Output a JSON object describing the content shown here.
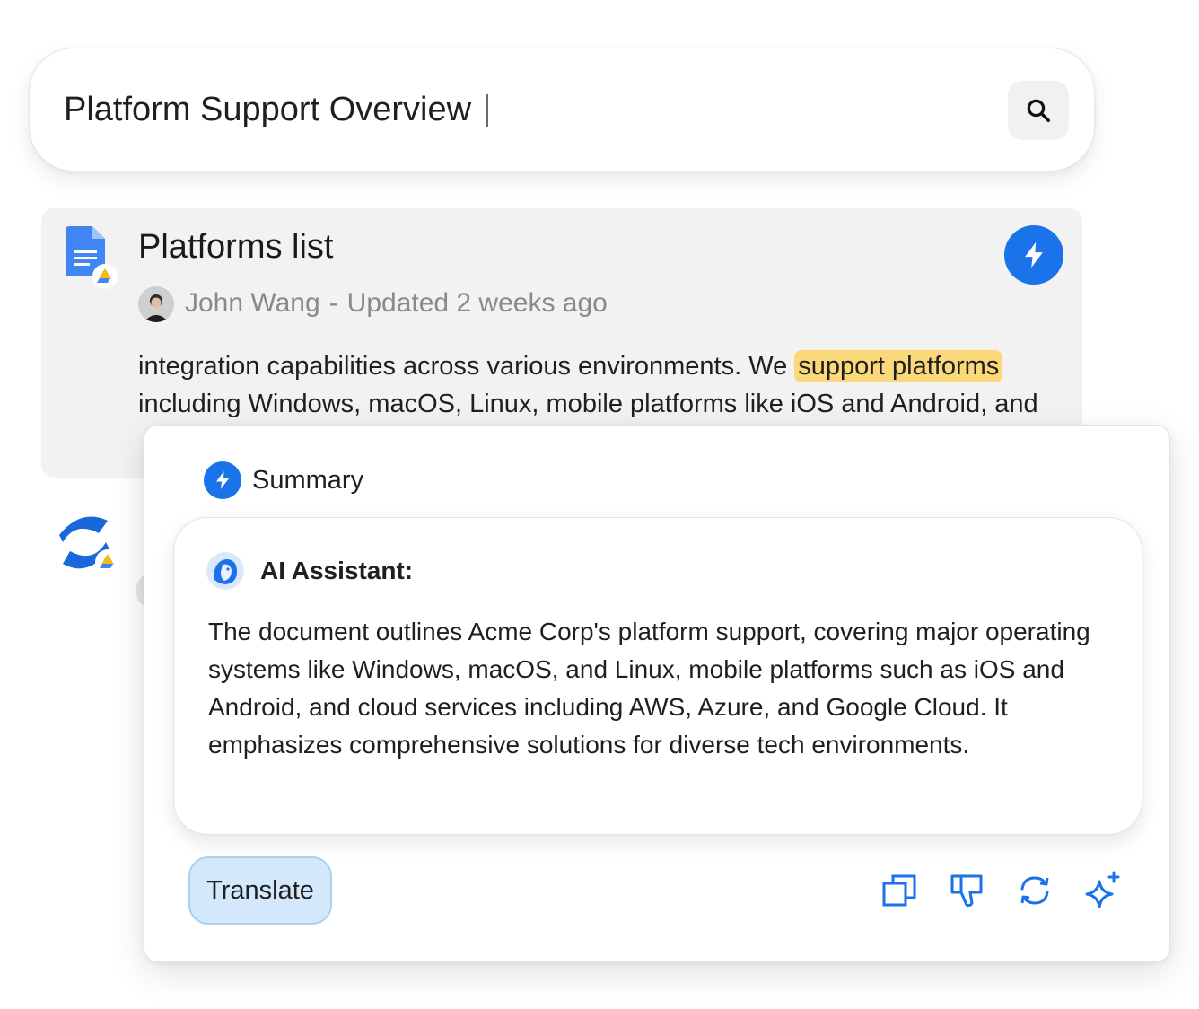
{
  "search": {
    "query": "Platform Support Overview",
    "search_icon": "search-icon"
  },
  "results": [
    {
      "title": "Platforms list",
      "icon": "google-docs-icon",
      "author": "John Wang",
      "separator": "-",
      "updated": "Updated 2 weeks ago",
      "snippet_before": "integration capabilities across various environments. We ",
      "snippet_highlight": "support platforms",
      "snippet_after": " including Windows, macOS, Linux, mobile platforms like iOS and Android, and",
      "action_icon": "lightning-icon"
    },
    {
      "icon": "confluence-icon"
    }
  ],
  "summary": {
    "label": "Summary",
    "assistant_name": "AI Assistant:",
    "text": "The document outlines Acme Corp's platform support, covering major operating systems like Windows, macOS, and Linux, mobile platforms such as iOS and Android, and cloud services including AWS, Azure, and Google Cloud. It emphasizes comprehensive solutions for diverse tech environments.",
    "translate_label": "Translate",
    "actions": [
      "copy-icon",
      "thumbs-down-icon",
      "refresh-icon",
      "sparkle-icon"
    ]
  },
  "colors": {
    "accent": "#1a73e8",
    "highlight": "#fbd97a",
    "translate_bg": "#d3e8fb"
  }
}
